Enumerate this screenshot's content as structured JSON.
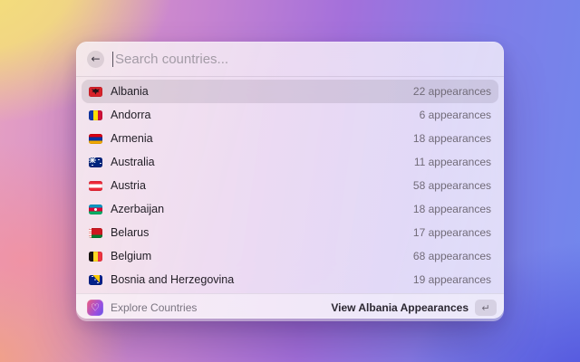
{
  "search": {
    "placeholder": "Search countries...",
    "back_glyph": "←"
  },
  "countries": [
    {
      "name": "Albania",
      "count": "22 appearances",
      "flag": "albania",
      "selected": true
    },
    {
      "name": "Andorra",
      "count": "6 appearances",
      "flag": "andorra",
      "selected": false
    },
    {
      "name": "Armenia",
      "count": "18 appearances",
      "flag": "armenia",
      "selected": false
    },
    {
      "name": "Australia",
      "count": "11 appearances",
      "flag": "australia",
      "selected": false
    },
    {
      "name": "Austria",
      "count": "58 appearances",
      "flag": "austria",
      "selected": false
    },
    {
      "name": "Azerbaijan",
      "count": "18 appearances",
      "flag": "azerbaijan",
      "selected": false
    },
    {
      "name": "Belarus",
      "count": "17 appearances",
      "flag": "belarus",
      "selected": false
    },
    {
      "name": "Belgium",
      "count": "68 appearances",
      "flag": "belgium",
      "selected": false
    },
    {
      "name": "Bosnia and Herzegovina",
      "count": "19 appearances",
      "flag": "bosnia",
      "selected": false
    }
  ],
  "footer": {
    "app_name": "Explore Countries",
    "action_label": "View Albania Appearances",
    "enter_glyph": "↵",
    "heart_glyph": "♡"
  },
  "colors": {
    "selected_row_bg": "rgba(70,60,75,0.13)",
    "app_icon_gradient_start": "#ED5C7E",
    "app_icon_gradient_end": "#6456E6",
    "bg_yellow": "#F2DF79",
    "bg_salmon": "#EC9C89",
    "bg_pink": "#E6A0C2",
    "bg_purple": "#A470DB",
    "bg_blue": "#7187EC",
    "bg_deep_blue": "#5C60D9"
  }
}
